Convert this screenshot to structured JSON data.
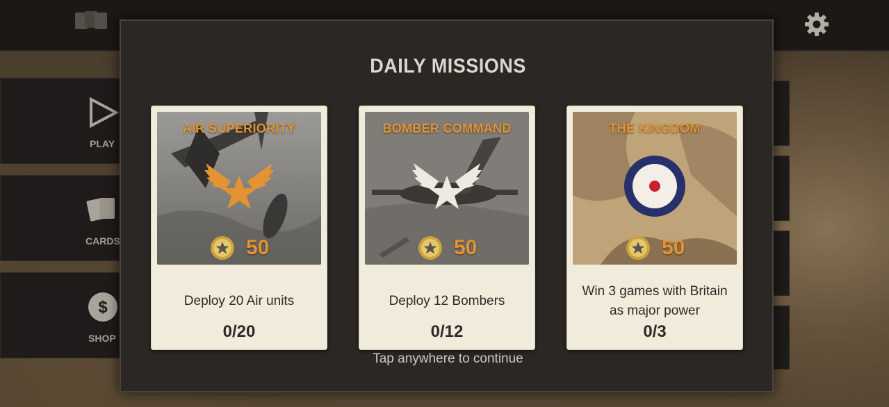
{
  "modal": {
    "title": "DAILY MISSIONS",
    "hint": "Tap anywhere to continue"
  },
  "missions": [
    {
      "name": "AIR SUPERIORITY",
      "reward": "50",
      "description": "Deploy 20 Air units",
      "progress": "0/20",
      "emblem": "winged-star-icon-orange"
    },
    {
      "name": "BOMBER COMMAND",
      "reward": "50",
      "description": "Deploy 12 Bombers",
      "progress": "0/12",
      "emblem": "winged-star-icon-white"
    },
    {
      "name": "THE KINGDOM",
      "reward": "50",
      "description": "Win 3 games with Britain as major power",
      "progress": "0/3",
      "emblem": "raf-roundel-icon"
    }
  ],
  "sidebar": {
    "items": [
      {
        "label": "PLAY",
        "icon": "play-icon"
      },
      {
        "label": "CARDS",
        "icon": "cards-icon"
      },
      {
        "label": "SHOP",
        "icon": "dollar-icon"
      }
    ]
  },
  "colors": {
    "accent": "#e39332",
    "card": "#f1ebdc",
    "modal": "#2a2724"
  }
}
